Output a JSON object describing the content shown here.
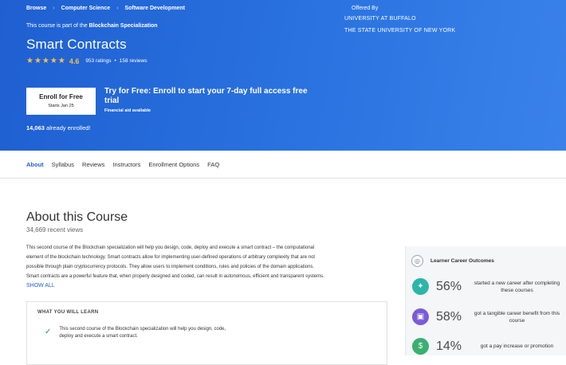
{
  "breadcrumb": [
    "Browse",
    "Computer Science",
    "Software Development"
  ],
  "part_of": {
    "prefix": "This course is part of the",
    "program": "Blockchain Specialization"
  },
  "course": {
    "title": "Smart Contracts",
    "stars": "★★★★★",
    "rating": "4.6",
    "ratings_count": "953 ratings",
    "bullet": "•",
    "reviews_count": "158 reviews"
  },
  "offered_by": {
    "label": "Offered By",
    "names": [
      "University at Buffalo",
      "The State University of New York"
    ]
  },
  "enroll": {
    "main": "Enroll for Free",
    "sub": "Starts Jan 25"
  },
  "try_free": {
    "headline": "Try for Free: Enroll to start your 7-day full access free trial",
    "aid": "Financial aid available"
  },
  "enrolled": {
    "count": "14,063",
    "suffix": "already enrolled!"
  },
  "tabs": [
    "About",
    "Syllabus",
    "Reviews",
    "Instructors",
    "Enrollment Options",
    "FAQ"
  ],
  "about": {
    "title": "About this Course",
    "views": "34,669 recent views",
    "lines": [
      "This second course of the Blockchain specialization will help you design, code, deploy and execute a smart contract – the computational",
      "element of the blockchain technology. Smart contracts allow for implementing user-defined operations of arbitrary complexity that are not",
      "possible through plain cryptocurrency protocols. They allow users to implement conditions, rules and policies of the domain applications.",
      "Smart contracts are a powerful feature that, when properly designed and coded, can result in autonomous, efficient and transparent systems."
    ],
    "show_all": "SHOW ALL"
  },
  "learn": {
    "heading": "WHAT YOU WILL LEARN",
    "items": [
      "This second course of the Blockchain specialization will help you design, code, deploy and execute a smart contract."
    ]
  },
  "outcomes": {
    "heading": "Learner Career Outcomes",
    "stats": [
      {
        "pct": "56%",
        "label": "started a new career after completing these courses",
        "color": "#2bb6a8",
        "icon": "compass-icon"
      },
      {
        "pct": "58%",
        "label": "got a tangible career benefit from this course",
        "color": "#7a5bd6",
        "icon": "briefcase-icon"
      },
      {
        "pct": "14%",
        "label": "got a pay increase or promotion",
        "color": "#3ab070",
        "icon": "dollar-icon"
      }
    ]
  },
  "colors": {
    "hero": "#2a73e0",
    "accent": "#1f5fd1",
    "stars": "#f5c04b"
  }
}
